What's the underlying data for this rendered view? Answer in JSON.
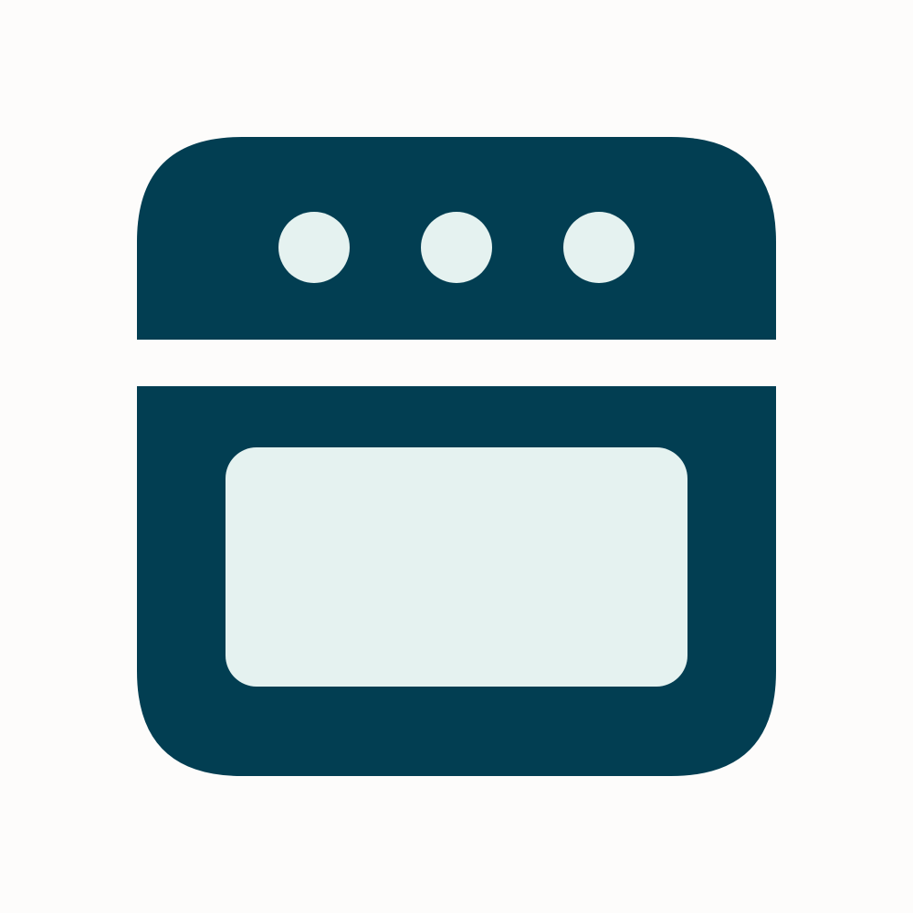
{
  "icon": {
    "name": "oven-icon",
    "body_color": "#023e52",
    "detail_color": "#e5f2f0",
    "background_color": "#fdfcfb"
  }
}
